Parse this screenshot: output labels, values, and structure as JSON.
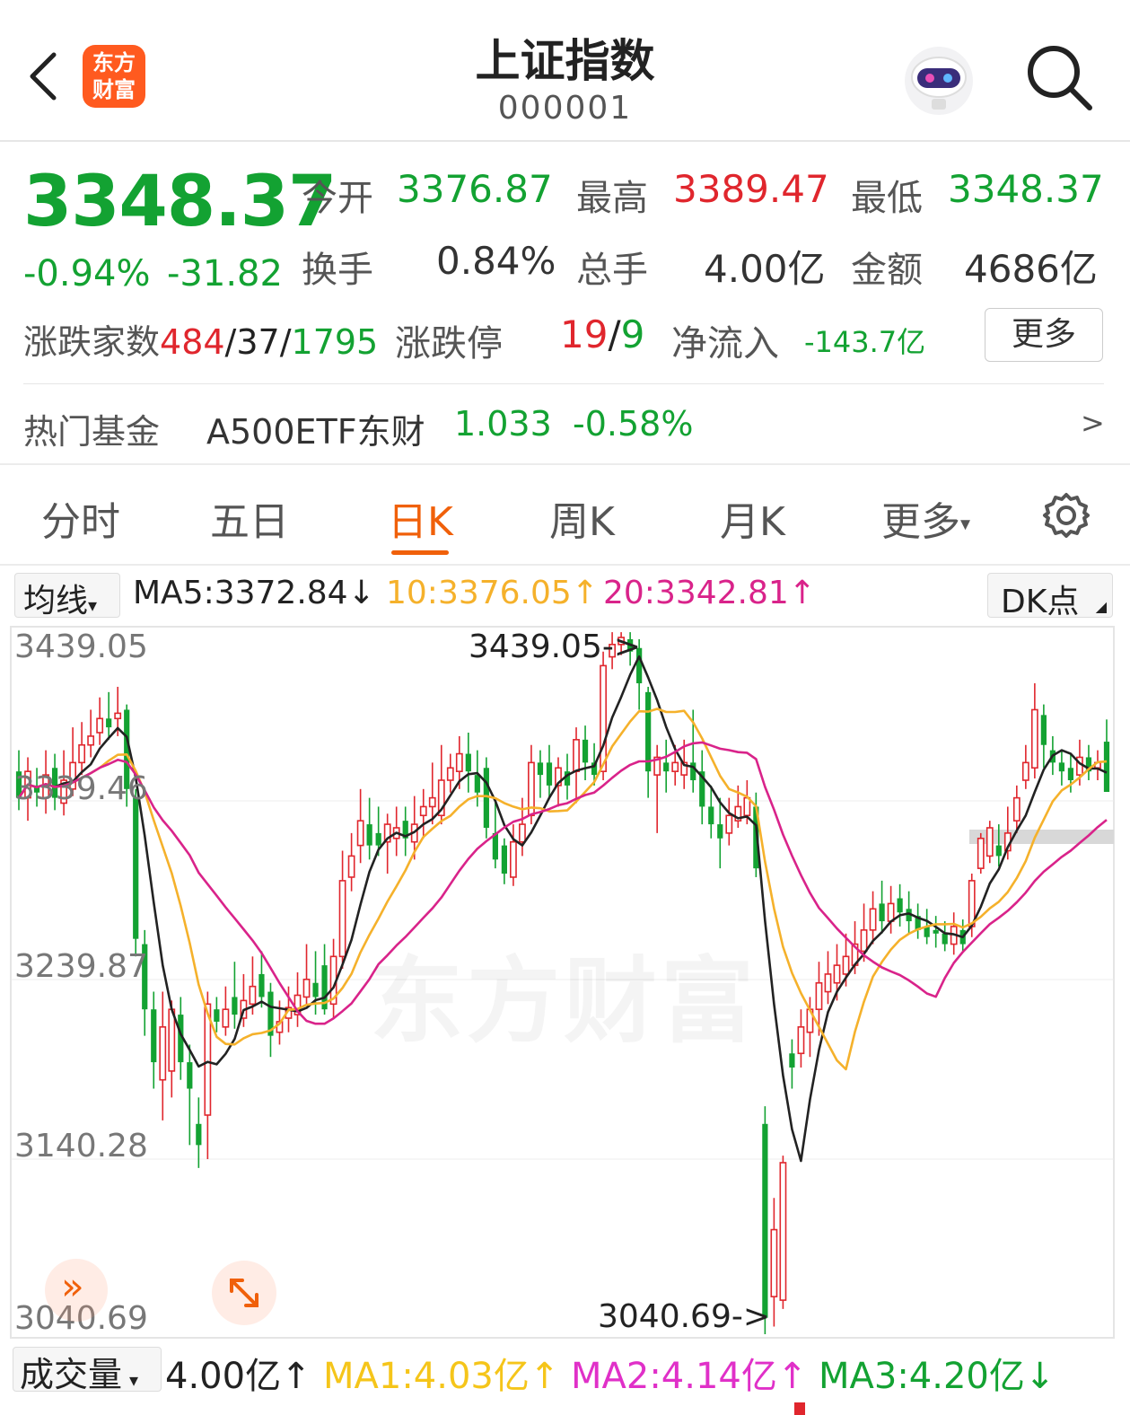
{
  "header": {
    "logo_text_line1": "东方",
    "logo_text_line2": "财富",
    "title": "上证指数",
    "code": "000001"
  },
  "quote": {
    "price": "3348.37",
    "change_pct": "-0.94%",
    "change": "-31.82",
    "open_label": "今开",
    "open": "3376.87",
    "high_label": "最高",
    "high": "3389.47",
    "low_label": "最低",
    "low": "3348.37",
    "turnover_label": "换手",
    "turnover": "0.84%",
    "volume_label": "总手",
    "volume": "4.00亿",
    "amount_label": "金额",
    "amount": "4686亿",
    "breadth_label": "涨跌家数",
    "breadth_up": "484",
    "breadth_flat": "37",
    "breadth_down": "1795",
    "limit_label": "涨跌停",
    "limit_up": "19",
    "limit_down": "9",
    "netflow_label": "净流入",
    "netflow": "-143.7亿",
    "more_label": "更多"
  },
  "fund": {
    "label": "热门基金",
    "name": "A500ETF东财",
    "price": "1.033",
    "change": "-0.58%",
    "arrow": ">"
  },
  "tabs": [
    "分时",
    "五日",
    "日K",
    "周K",
    "月K",
    "更多"
  ],
  "active_tab": "日K",
  "ma_bar": {
    "selector": "均线",
    "ma5": "MA5:3372.84↓",
    "ma10": "10:3376.05↑",
    "ma20": "20:3342.81↑",
    "dk": "DK点"
  },
  "chart": {
    "watermark": "东方财富",
    "y_labels": [
      "3439.05",
      "3339.46",
      "3239.87",
      "3140.28",
      "3040.69"
    ],
    "high_marker": "3439.05->",
    "low_marker": "3040.69->"
  },
  "volume_bar": {
    "selector": "成交量",
    "vol": "4.00亿↑",
    "ma1": "MA1:4.03亿↑",
    "ma2": "MA2:4.14亿↑",
    "ma3": "MA3:4.20亿↓"
  },
  "colors": {
    "up": "#e0262d",
    "down": "#13a232",
    "ma5": "#222222",
    "ma10": "#f5b12b",
    "ma20": "#d9238a",
    "accent": "#f0600a"
  },
  "chart_data": {
    "type": "candlestick",
    "ylim": [
      3040.69,
      3439.05
    ],
    "candles": [
      {
        "o": 3360,
        "c": 3345,
        "h": 3372,
        "l": 3338
      },
      {
        "o": 3345,
        "c": 3360,
        "h": 3368,
        "l": 3332
      },
      {
        "o": 3352,
        "c": 3348,
        "h": 3362,
        "l": 3340
      },
      {
        "o": 3345,
        "c": 3358,
        "h": 3372,
        "l": 3336
      },
      {
        "o": 3362,
        "c": 3345,
        "h": 3370,
        "l": 3338
      },
      {
        "o": 3342,
        "c": 3355,
        "h": 3372,
        "l": 3335
      },
      {
        "o": 3350,
        "c": 3365,
        "h": 3385,
        "l": 3346
      },
      {
        "o": 3365,
        "c": 3375,
        "h": 3388,
        "l": 3358
      },
      {
        "o": 3375,
        "c": 3380,
        "h": 3395,
        "l": 3368
      },
      {
        "o": 3382,
        "c": 3390,
        "h": 3402,
        "l": 3375
      },
      {
        "o": 3390,
        "c": 3385,
        "h": 3405,
        "l": 3378
      },
      {
        "o": 3390,
        "c": 3393,
        "h": 3408,
        "l": 3380
      },
      {
        "o": 3395,
        "c": 3350,
        "h": 3398,
        "l": 3340
      },
      {
        "o": 3345,
        "c": 3265,
        "h": 3350,
        "l": 3255
      },
      {
        "o": 3262,
        "c": 3225,
        "h": 3270,
        "l": 3210
      },
      {
        "o": 3225,
        "c": 3195,
        "h": 3235,
        "l": 3180
      },
      {
        "o": 3185,
        "c": 3215,
        "h": 3235,
        "l": 3162
      },
      {
        "o": 3190,
        "c": 3225,
        "h": 3230,
        "l": 3175
      },
      {
        "o": 3222,
        "c": 3195,
        "h": 3232,
        "l": 3185
      },
      {
        "o": 3195,
        "c": 3180,
        "h": 3205,
        "l": 3148
      },
      {
        "o": 3160,
        "c": 3148,
        "h": 3175,
        "l": 3135
      },
      {
        "o": 3165,
        "c": 3228,
        "h": 3235,
        "l": 3140
      },
      {
        "o": 3225,
        "c": 3218,
        "h": 3232,
        "l": 3212
      },
      {
        "o": 3215,
        "c": 3225,
        "h": 3238,
        "l": 3210
      },
      {
        "o": 3232,
        "c": 3222,
        "h": 3252,
        "l": 3214
      },
      {
        "o": 3220,
        "c": 3230,
        "h": 3245,
        "l": 3215
      },
      {
        "o": 3228,
        "c": 3238,
        "h": 3255,
        "l": 3222
      },
      {
        "o": 3245,
        "c": 3232,
        "h": 3258,
        "l": 3226
      },
      {
        "o": 3235,
        "c": 3210,
        "h": 3240,
        "l": 3198
      },
      {
        "o": 3212,
        "c": 3218,
        "h": 3230,
        "l": 3205
      },
      {
        "o": 3220,
        "c": 3226,
        "h": 3238,
        "l": 3212
      },
      {
        "o": 3222,
        "c": 3233,
        "h": 3246,
        "l": 3215
      },
      {
        "o": 3232,
        "c": 3242,
        "h": 3262,
        "l": 3228
      },
      {
        "o": 3240,
        "c": 3232,
        "h": 3258,
        "l": 3222
      },
      {
        "o": 3250,
        "c": 3225,
        "h": 3262,
        "l": 3222
      },
      {
        "o": 3228,
        "c": 3255,
        "h": 3265,
        "l": 3220
      },
      {
        "o": 3255,
        "c": 3298,
        "h": 3315,
        "l": 3248
      },
      {
        "o": 3300,
        "c": 3312,
        "h": 3325,
        "l": 3292
      },
      {
        "o": 3318,
        "c": 3332,
        "h": 3350,
        "l": 3308
      },
      {
        "o": 3330,
        "c": 3318,
        "h": 3345,
        "l": 3310
      },
      {
        "o": 3325,
        "c": 3318,
        "h": 3340,
        "l": 3312
      },
      {
        "o": 3320,
        "c": 3330,
        "h": 3336,
        "l": 3302
      },
      {
        "o": 3322,
        "c": 3328,
        "h": 3340,
        "l": 3312
      },
      {
        "o": 3332,
        "c": 3322,
        "h": 3340,
        "l": 3312
      },
      {
        "o": 3320,
        "c": 3330,
        "h": 3346,
        "l": 3310
      },
      {
        "o": 3335,
        "c": 3340,
        "h": 3350,
        "l": 3322
      },
      {
        "o": 3340,
        "c": 3345,
        "h": 3365,
        "l": 3330
      },
      {
        "o": 3335,
        "c": 3355,
        "h": 3375,
        "l": 3330
      },
      {
        "o": 3355,
        "c": 3362,
        "h": 3370,
        "l": 3348
      },
      {
        "o": 3360,
        "c": 3370,
        "h": 3380,
        "l": 3350
      },
      {
        "o": 3370,
        "c": 3360,
        "h": 3382,
        "l": 3348
      },
      {
        "o": 3358,
        "c": 3348,
        "h": 3372,
        "l": 3340
      },
      {
        "o": 3362,
        "c": 3328,
        "h": 3368,
        "l": 3322
      },
      {
        "o": 3325,
        "c": 3310,
        "h": 3345,
        "l": 3305
      },
      {
        "o": 3318,
        "c": 3302,
        "h": 3322,
        "l": 3296
      },
      {
        "o": 3300,
        "c": 3320,
        "h": 3330,
        "l": 3295
      },
      {
        "o": 3320,
        "c": 3330,
        "h": 3345,
        "l": 3312
      },
      {
        "o": 3335,
        "c": 3365,
        "h": 3375,
        "l": 3330
      },
      {
        "o": 3365,
        "c": 3358,
        "h": 3372,
        "l": 3345
      },
      {
        "o": 3365,
        "c": 3352,
        "h": 3375,
        "l": 3345
      },
      {
        "o": 3352,
        "c": 3362,
        "h": 3368,
        "l": 3340
      },
      {
        "o": 3360,
        "c": 3352,
        "h": 3370,
        "l": 3344
      },
      {
        "o": 3360,
        "c": 3378,
        "h": 3385,
        "l": 3342
      },
      {
        "o": 3378,
        "c": 3365,
        "h": 3386,
        "l": 3355
      },
      {
        "o": 3365,
        "c": 3358,
        "h": 3376,
        "l": 3352
      },
      {
        "o": 3360,
        "c": 3420,
        "h": 3428,
        "l": 3355
      },
      {
        "o": 3425,
        "c": 3432,
        "h": 3439,
        "l": 3418
      },
      {
        "o": 3432,
        "c": 3436,
        "h": 3439,
        "l": 3426
      },
      {
        "o": 3435,
        "c": 3428,
        "h": 3439,
        "l": 3420
      },
      {
        "o": 3430,
        "c": 3410,
        "h": 3435,
        "l": 3395
      },
      {
        "o": 3405,
        "c": 3360,
        "h": 3408,
        "l": 3345
      },
      {
        "o": 3358,
        "c": 3368,
        "h": 3375,
        "l": 3325
      },
      {
        "o": 3365,
        "c": 3360,
        "h": 3378,
        "l": 3348
      },
      {
        "o": 3360,
        "c": 3365,
        "h": 3375,
        "l": 3352
      },
      {
        "o": 3358,
        "c": 3365,
        "h": 3378,
        "l": 3350
      },
      {
        "o": 3365,
        "c": 3355,
        "h": 3395,
        "l": 3348
      },
      {
        "o": 3360,
        "c": 3340,
        "h": 3372,
        "l": 3330
      },
      {
        "o": 3340,
        "c": 3330,
        "h": 3352,
        "l": 3322
      },
      {
        "o": 3330,
        "c": 3322,
        "h": 3345,
        "l": 3305
      },
      {
        "o": 3325,
        "c": 3335,
        "h": 3345,
        "l": 3318
      },
      {
        "o": 3332,
        "c": 3340,
        "h": 3352,
        "l": 3328
      },
      {
        "o": 3335,
        "c": 3345,
        "h": 3355,
        "l": 3330
      },
      {
        "o": 3340,
        "c": 3305,
        "h": 3348,
        "l": 3300
      },
      {
        "o": 3160,
        "c": 3050,
        "h": 3170,
        "l": 3040.69
      },
      {
        "o": 3062,
        "c": 3100,
        "h": 3118,
        "l": 3045
      },
      {
        "o": 3060,
        "c": 3138,
        "h": 3142,
        "l": 3055
      },
      {
        "o": 3200,
        "c": 3192,
        "h": 3208,
        "l": 3180
      },
      {
        "o": 3200,
        "c": 3215,
        "h": 3225,
        "l": 3192
      },
      {
        "o": 3212,
        "c": 3225,
        "h": 3232,
        "l": 3198
      },
      {
        "o": 3225,
        "c": 3240,
        "h": 3252,
        "l": 3210
      },
      {
        "o": 3235,
        "c": 3245,
        "h": 3258,
        "l": 3228
      },
      {
        "o": 3240,
        "c": 3250,
        "h": 3262,
        "l": 3230
      },
      {
        "o": 3245,
        "c": 3255,
        "h": 3268,
        "l": 3238
      },
      {
        "o": 3250,
        "c": 3262,
        "h": 3275,
        "l": 3245
      },
      {
        "o": 3258,
        "c": 3270,
        "h": 3285,
        "l": 3252
      },
      {
        "o": 3270,
        "c": 3282,
        "h": 3292,
        "l": 3262
      },
      {
        "o": 3285,
        "c": 3275,
        "h": 3298,
        "l": 3268
      },
      {
        "o": 3275,
        "c": 3285,
        "h": 3295,
        "l": 3268
      },
      {
        "o": 3288,
        "c": 3280,
        "h": 3296,
        "l": 3272
      },
      {
        "o": 3282,
        "c": 3275,
        "h": 3292,
        "l": 3268
      },
      {
        "o": 3278,
        "c": 3270,
        "h": 3285,
        "l": 3265
      },
      {
        "o": 3272,
        "c": 3266,
        "h": 3282,
        "l": 3262
      },
      {
        "o": 3270,
        "c": 3268,
        "h": 3278,
        "l": 3260
      },
      {
        "o": 3268,
        "c": 3262,
        "h": 3275,
        "l": 3258
      },
      {
        "o": 3262,
        "c": 3272,
        "h": 3280,
        "l": 3256
      },
      {
        "o": 3270,
        "c": 3262,
        "h": 3276,
        "l": 3258
      },
      {
        "o": 3272,
        "c": 3298,
        "h": 3302,
        "l": 3266
      },
      {
        "o": 3305,
        "c": 3322,
        "h": 3325,
        "l": 3302
      },
      {
        "o": 3312,
        "c": 3328,
        "h": 3332,
        "l": 3308
      },
      {
        "o": 3318,
        "c": 3312,
        "h": 3330,
        "l": 3306
      },
      {
        "o": 3315,
        "c": 3325,
        "h": 3340,
        "l": 3310
      },
      {
        "o": 3332,
        "c": 3345,
        "h": 3352,
        "l": 3325
      },
      {
        "o": 3355,
        "c": 3365,
        "h": 3375,
        "l": 3350
      },
      {
        "o": 3362,
        "c": 3395,
        "h": 3410,
        "l": 3356
      },
      {
        "o": 3392,
        "c": 3375,
        "h": 3398,
        "l": 3362
      },
      {
        "o": 3372,
        "c": 3365,
        "h": 3380,
        "l": 3358
      },
      {
        "o": 3365,
        "c": 3360,
        "h": 3372,
        "l": 3352
      },
      {
        "o": 3362,
        "c": 3355,
        "h": 3370,
        "l": 3348
      },
      {
        "o": 3358,
        "c": 3368,
        "h": 3378,
        "l": 3352
      },
      {
        "o": 3368,
        "c": 3360,
        "h": 3375,
        "l": 3355
      },
      {
        "o": 3362,
        "c": 3365,
        "h": 3372,
        "l": 3355
      },
      {
        "o": 3376.87,
        "c": 3348.37,
        "h": 3389.47,
        "l": 3348.37
      }
    ]
  }
}
